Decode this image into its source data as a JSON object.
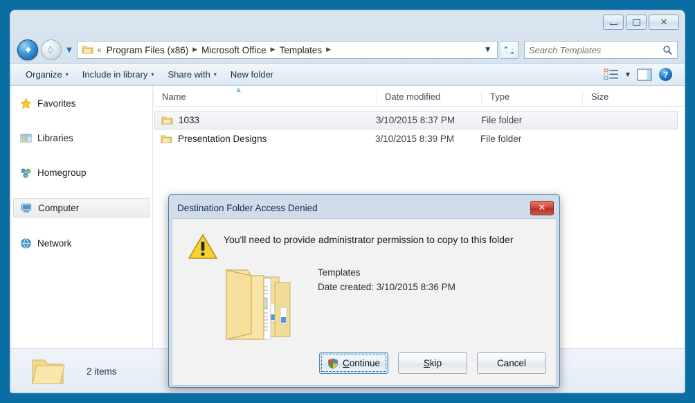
{
  "window": {
    "caption_buttons": [
      {
        "name": "minimize",
        "label": "–"
      },
      {
        "name": "maximize",
        "label": "□"
      },
      {
        "name": "close",
        "label": "✕"
      }
    ]
  },
  "address_bar": {
    "back_label": "←",
    "forward_label": "⇒",
    "history_caret": "▼",
    "folder_icon": "folder-icon",
    "path_prefix": "«",
    "crumbs": [
      "Program Files (x86)",
      "Microsoft Office",
      "Templates"
    ],
    "separator": "▶",
    "dropdown_caret": "▼",
    "refresh_label": "↺",
    "search_placeholder": "Search Templates",
    "search_value": "",
    "search_icon": "🔍"
  },
  "toolbar": {
    "items": [
      {
        "label": "Organize",
        "has_caret": true
      },
      {
        "label": "Include in library",
        "has_caret": true
      },
      {
        "label": "Share with",
        "has_caret": true
      },
      {
        "label": "New folder",
        "has_caret": false
      }
    ],
    "caret": "▾",
    "view_caret": "▼",
    "help_label": "?"
  },
  "nav_pane": {
    "items": [
      {
        "label": "Favorites",
        "icon": "star-icon",
        "selected": false
      },
      {
        "label": "Libraries",
        "icon": "libraries-icon",
        "selected": false
      },
      {
        "label": "Homegroup",
        "icon": "homegroup-icon",
        "selected": false
      },
      {
        "label": "Computer",
        "icon": "computer-icon",
        "selected": true
      },
      {
        "label": "Network",
        "icon": "network-icon",
        "selected": false
      }
    ]
  },
  "file_list": {
    "columns": [
      "Name",
      "Date modified",
      "Type",
      "Size"
    ],
    "sort_caret": "▲",
    "rows": [
      {
        "name": "1033",
        "date": "3/10/2015 8:37 PM",
        "type": "File folder",
        "size": "",
        "selected": true
      },
      {
        "name": "Presentation Designs",
        "date": "3/10/2015 8:39 PM",
        "type": "File folder",
        "size": "",
        "selected": false
      }
    ]
  },
  "status_bar": {
    "text": "2 items",
    "icon": "folder-icon"
  },
  "dialog": {
    "title": "Destination Folder Access Denied",
    "close_label": "✕",
    "message": "You'll need to provide administrator permission to copy to this folder",
    "folder_name": "Templates",
    "date_created": "Date created: 3/10/2015 8:36 PM",
    "buttons": [
      {
        "label": "Continue",
        "accesskey": "C",
        "default": true,
        "shield": true
      },
      {
        "label": "Skip",
        "accesskey": "S",
        "default": false,
        "shield": false
      },
      {
        "label": "Cancel",
        "accesskey": "",
        "default": false,
        "shield": false
      }
    ]
  },
  "colors": {
    "desktop": "#0a6ea3",
    "window_chrome": "#cfdeee",
    "accent": "#2176c4",
    "warning": "#f5c518",
    "close_red": "#c8392b"
  }
}
